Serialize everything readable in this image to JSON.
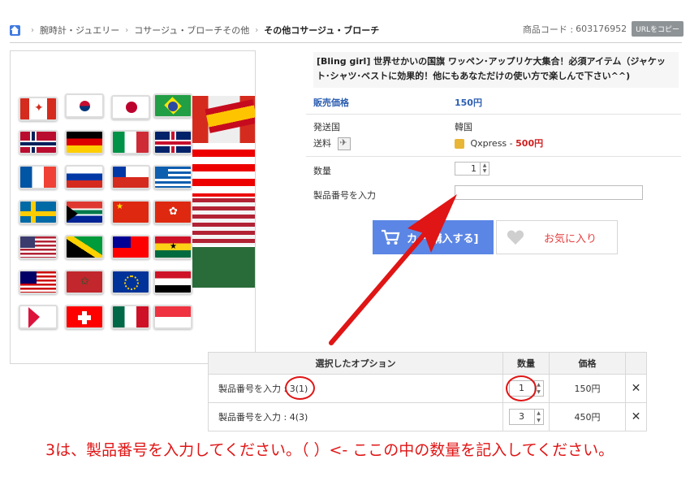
{
  "breadcrumb": {
    "items": [
      "腕時計・ジュエリー",
      "コサージュ・ブローチその他",
      "その他コサージュ・ブローチ"
    ]
  },
  "product_code": {
    "label": "商品コード :",
    "value": "603176952",
    "copy_label": "URLをコピー"
  },
  "product": {
    "title": "[Bling girl] 世界せかいの国旗 ワッペン･アップリケ大集合！必須アイテム（ジャケット･シャツ･ベストに効果的！他にもあなただけの使い方で楽しんで下さい^^)"
  },
  "details": {
    "price_label": "販売価格",
    "price_value": "150円",
    "origin_label": "発送国",
    "origin_value": "韓国",
    "shipping_label": "送料",
    "shipping_carrier": "Qxpress -",
    "shipping_price": "500円",
    "quantity_label": "数量",
    "quantity_value": "1",
    "serial_label": "製品番号を入力"
  },
  "buttons": {
    "cart_label": "カー 購入する]",
    "favorite_label": "お気に入り"
  },
  "options": {
    "headers": [
      "選択したオプション",
      "数量",
      "価格"
    ],
    "rows": [
      {
        "name_prefix": "製品番号を入力 :",
        "name_value": "3(1)",
        "qty": "1",
        "price": "150円",
        "delete": "✕"
      },
      {
        "name_prefix": "製品番号を入力 :",
        "name_value": "4(3)",
        "qty": "3",
        "price": "450円",
        "delete": "✕"
      }
    ]
  },
  "annotation": {
    "text": "3は、製品番号を入力してください。（ ）<- ここの中の数量を記入してください。"
  },
  "colors": {
    "accent_blue": "#2d5fb2",
    "cart_button": "#5b86e5",
    "annotation_red": "#e01515",
    "price_red": "#d01f1f"
  },
  "icons": [
    "home-icon",
    "plane-icon",
    "box-icon",
    "cart-icon",
    "heart-icon",
    "close-icon",
    "arrow-icon"
  ]
}
